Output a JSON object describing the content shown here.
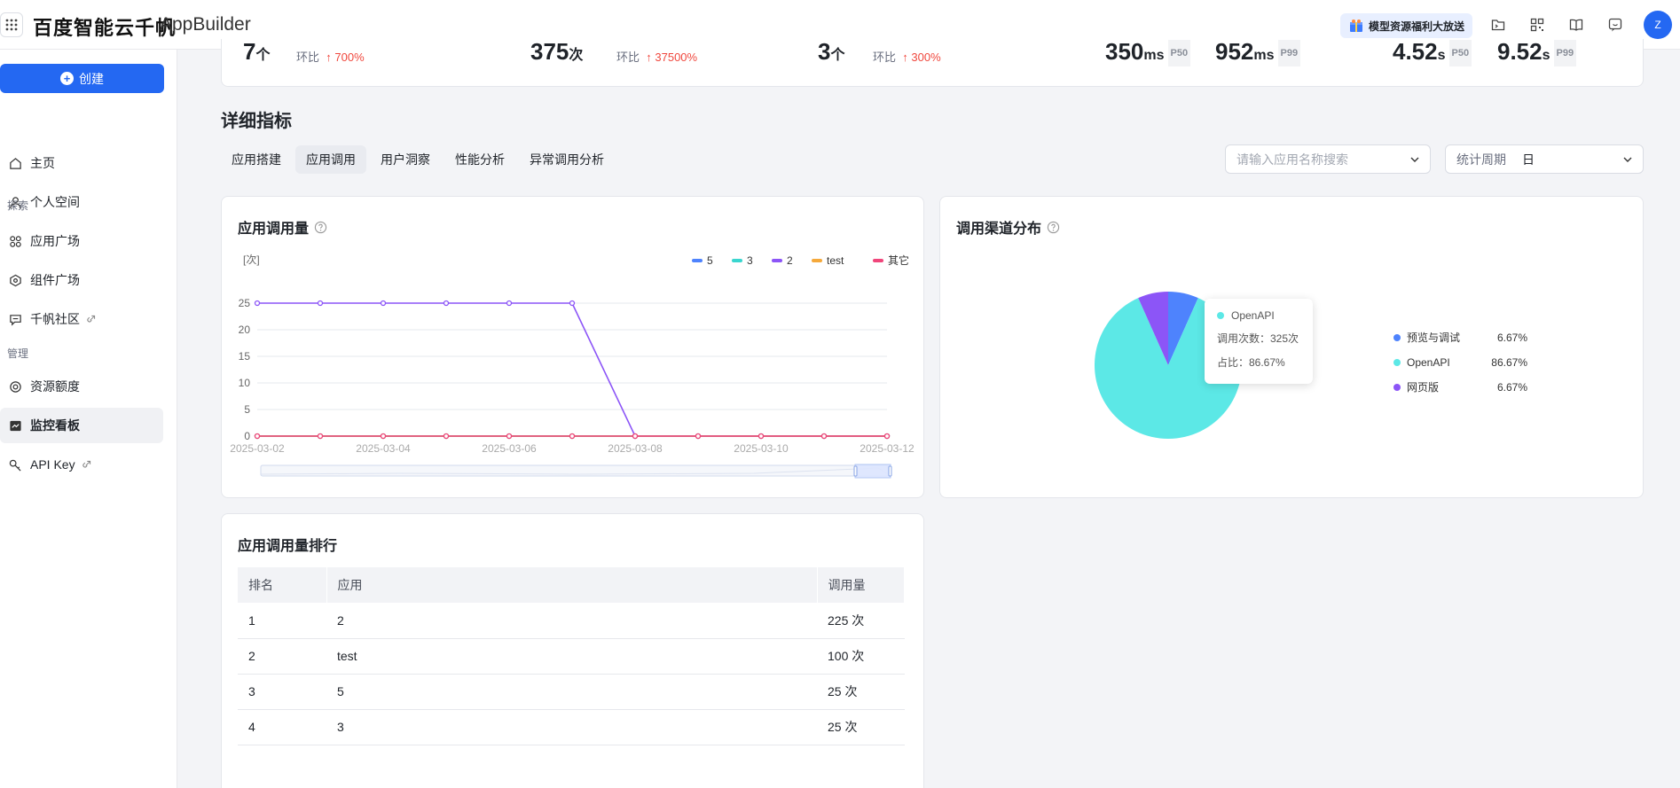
{
  "header": {
    "logo_cn": "百度智能云千帆",
    "logo_en": "AppBuilder",
    "promo": "模型资源福利大放送",
    "avatar": "Z"
  },
  "sidebar": {
    "create": "创建",
    "items": [
      {
        "label": "主页",
        "icon": "home-icon"
      },
      {
        "label": "个人空间",
        "icon": "user-icon"
      },
      {
        "label": "应用广场",
        "icon": "apps-icon"
      },
      {
        "label": "组件广场",
        "icon": "component-icon"
      },
      {
        "label": "千帆社区",
        "icon": "community-icon"
      },
      {
        "label": "资源额度",
        "icon": "quota-icon"
      },
      {
        "label": "监控看板",
        "icon": "dashboard-icon"
      },
      {
        "label": "API Key",
        "icon": "key-icon"
      }
    ],
    "section_explore": "探索",
    "section_manage": "管理"
  },
  "stats": {
    "s1_value": "7",
    "s1_unit": "个",
    "s1_label": "环比",
    "s1_change": "700%",
    "s2_value": "375",
    "s2_unit": "次",
    "s2_label": "环比",
    "s2_change": "37500%",
    "s3_value": "3",
    "s3_unit": "个",
    "s3_label": "环比",
    "s3_change": "300%",
    "s4_value": "350",
    "s4_unit": "ms",
    "s4_tag": "P50",
    "s5_value": "952",
    "s5_unit": "ms",
    "s5_tag": "P99",
    "s6_value": "4.52",
    "s6_unit": "s",
    "s6_tag": "P50",
    "s7_value": "9.52",
    "s7_unit": "s",
    "s7_tag": "P99"
  },
  "detail": {
    "title": "详细指标",
    "tabs": [
      "应用搭建",
      "应用调用",
      "用户洞察",
      "性能分析",
      "异常调用分析"
    ],
    "active_tab": "应用调用",
    "search_placeholder": "请输入应用名称搜索",
    "period_label": "统计周期",
    "period_value": "日"
  },
  "call_chart": {
    "title": "应用调用量",
    "unit_label": "[次]"
  },
  "channel_chart": {
    "title": "调用渠道分布",
    "tooltip_name": "OpenAPI",
    "tooltip_count": "调用次数：325次",
    "tooltip_pct": "占比：86.67%"
  },
  "ranking": {
    "title": "应用调用量排行",
    "columns": [
      "排名",
      "应用",
      "调用量"
    ],
    "rows": [
      [
        "1",
        "2",
        "225 次"
      ],
      [
        "2",
        "test",
        "100 次"
      ],
      [
        "3",
        "5",
        "25 次"
      ],
      [
        "4",
        "3",
        "25 次"
      ]
    ]
  },
  "colors": {
    "accent": "#2468f2",
    "up": "#f0483e"
  },
  "chart_data": [
    {
      "type": "line",
      "title": "应用调用量",
      "ylabel": "[次]",
      "ylim": [
        0,
        25
      ],
      "yticks": [
        "0",
        "5",
        "10",
        "15",
        "20",
        "25"
      ],
      "x": [
        "2025-03-02",
        "2025-03-03",
        "2025-03-04",
        "2025-03-05",
        "2025-03-06",
        "2025-03-07",
        "2025-03-08",
        "2025-03-09",
        "2025-03-10",
        "2025-03-11",
        "2025-03-12"
      ],
      "xticks": [
        "2025-03-02",
        "2025-03-04",
        "2025-03-06",
        "2025-03-08",
        "2025-03-10",
        "2025-03-12"
      ],
      "legend_position": "top-right",
      "series": [
        {
          "name": "5",
          "color": "#4e83fd",
          "values": [
            0,
            0,
            0,
            0,
            0,
            0,
            0,
            0,
            0,
            0,
            0
          ]
        },
        {
          "name": "3",
          "color": "#3ad6cf",
          "values": [
            0,
            0,
            0,
            0,
            0,
            0,
            0,
            0,
            0,
            0,
            0
          ]
        },
        {
          "name": "2",
          "color": "#8c55f7",
          "values": [
            25,
            25,
            25,
            25,
            25,
            25,
            0,
            0,
            0,
            0,
            0
          ]
        },
        {
          "name": "test",
          "color": "#f5a93b",
          "values": [
            0,
            0,
            0,
            0,
            0,
            0,
            0,
            0,
            0,
            0,
            0
          ]
        },
        {
          "name": "其它",
          "color": "#f0467b",
          "values": [
            0,
            0,
            0,
            0,
            0,
            0,
            0,
            0,
            0,
            0,
            0
          ]
        }
      ]
    },
    {
      "type": "pie",
      "title": "调用渠道分布",
      "legend_position": "right",
      "slices": [
        {
          "name": "预览与调试",
          "value": 6.67,
          "label": "6.67%",
          "color": "#4e83fd"
        },
        {
          "name": "OpenAPI",
          "value": 86.67,
          "label": "86.67%",
          "color": "#5ce8e6"
        },
        {
          "name": "网页版",
          "value": 6.67,
          "label": "6.67%",
          "color": "#8c55f7"
        }
      ]
    }
  ]
}
